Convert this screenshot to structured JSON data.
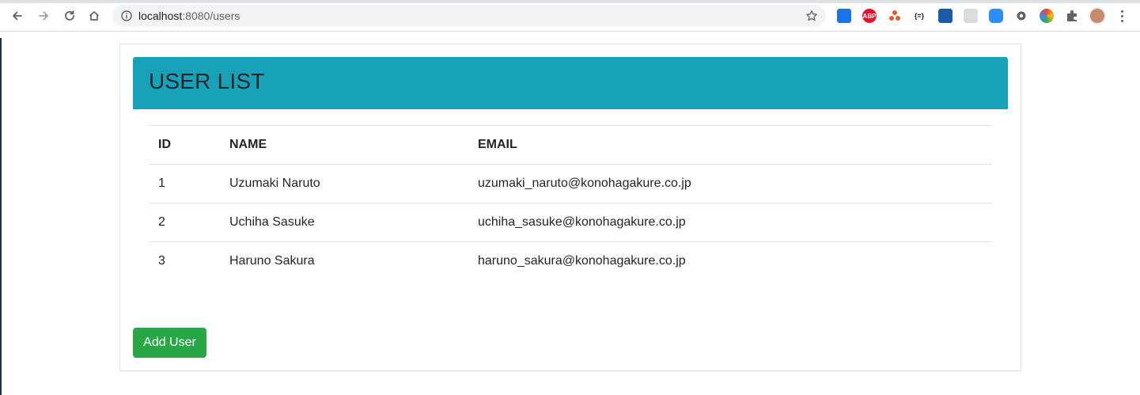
{
  "browser": {
    "url_host": "localhost",
    "url_rest": ":8080/users",
    "extensions": [
      "image-icon",
      "adblock-icon",
      "octotree-icon",
      "json-viewer-icon",
      "s-extension-icon",
      "gray-extension-icon",
      "zoom-icon",
      "gear-extension-icon",
      "color-picker-icon",
      "puzzle-icon"
    ],
    "extension_labels": {
      "adblock": "ABP",
      "json": "{=}"
    }
  },
  "page": {
    "title": "USER LIST",
    "table": {
      "headers": [
        "ID",
        "NAME",
        "EMAIL"
      ],
      "rows": [
        {
          "id": "1",
          "name": "Uzumaki Naruto",
          "email": "uzumaki_naruto@konohagakure.co.jp"
        },
        {
          "id": "2",
          "name": "Uchiha Sasuke",
          "email": "uchiha_sasuke@konohagakure.co.jp"
        },
        {
          "id": "3",
          "name": "Haruno Sakura",
          "email": "haruno_sakura@konohagakure.co.jp"
        }
      ]
    },
    "add_button_label": "Add User"
  },
  "colors": {
    "header_bg": "#17a2b8",
    "button_bg": "#28a745"
  }
}
